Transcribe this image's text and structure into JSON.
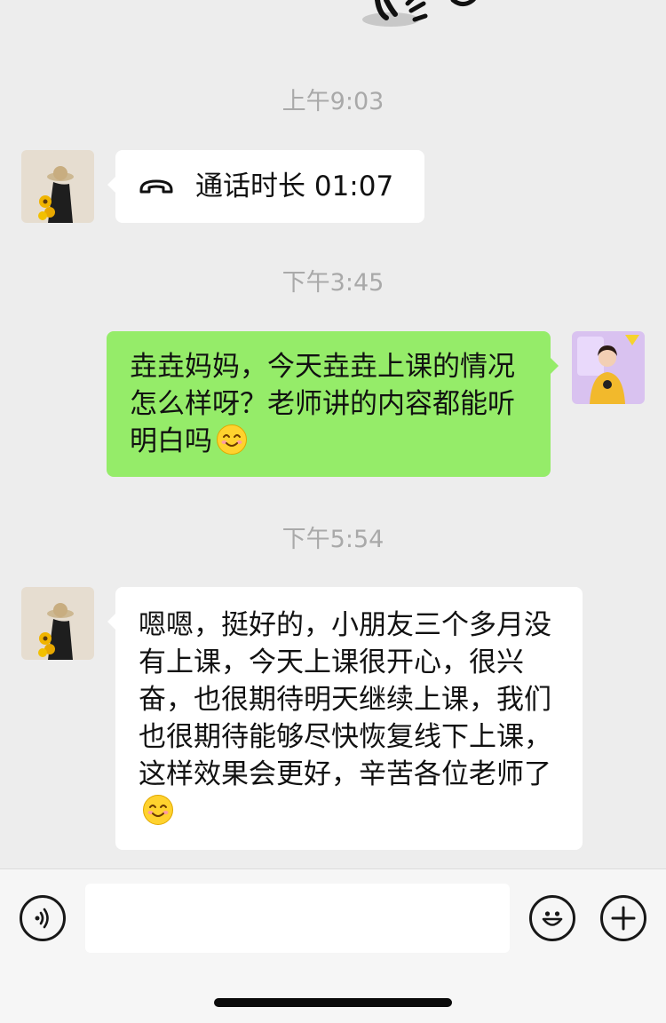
{
  "chat": {
    "messages": [
      {
        "timestamp": "上午9:03",
        "sender": "contact",
        "type": "call",
        "call_label": "通话时长 01:07",
        "call_icon": "phone-hangup-icon"
      },
      {
        "timestamp": "下午3:45",
        "sender": "self",
        "type": "text",
        "text": "垚垚妈妈，今天垚垚上课的情况怎么样呀？老师讲的内容都能听明白吗",
        "emoji": "smile-emoji"
      },
      {
        "timestamp": "下午5:54",
        "sender": "contact",
        "type": "text",
        "text": "嗯嗯，挺好的，小朋友三个多月没有上课，今天上课很开心，很兴奋，也很期待明天继续上课，我们也很期待能够尽快恢复线下上课，这样效果会更好，辛苦各位老师了",
        "emoji": "smile-emoji"
      }
    ]
  },
  "input_bar": {
    "voice_icon": "voice-icon",
    "message_value": "",
    "emoji_icon": "emoji-icon",
    "plus_icon": "plus-icon"
  },
  "colors": {
    "background": "#ededed",
    "self_bubble": "#95ec69",
    "contact_bubble": "#ffffff",
    "timestamp": "#a9a9a9"
  }
}
